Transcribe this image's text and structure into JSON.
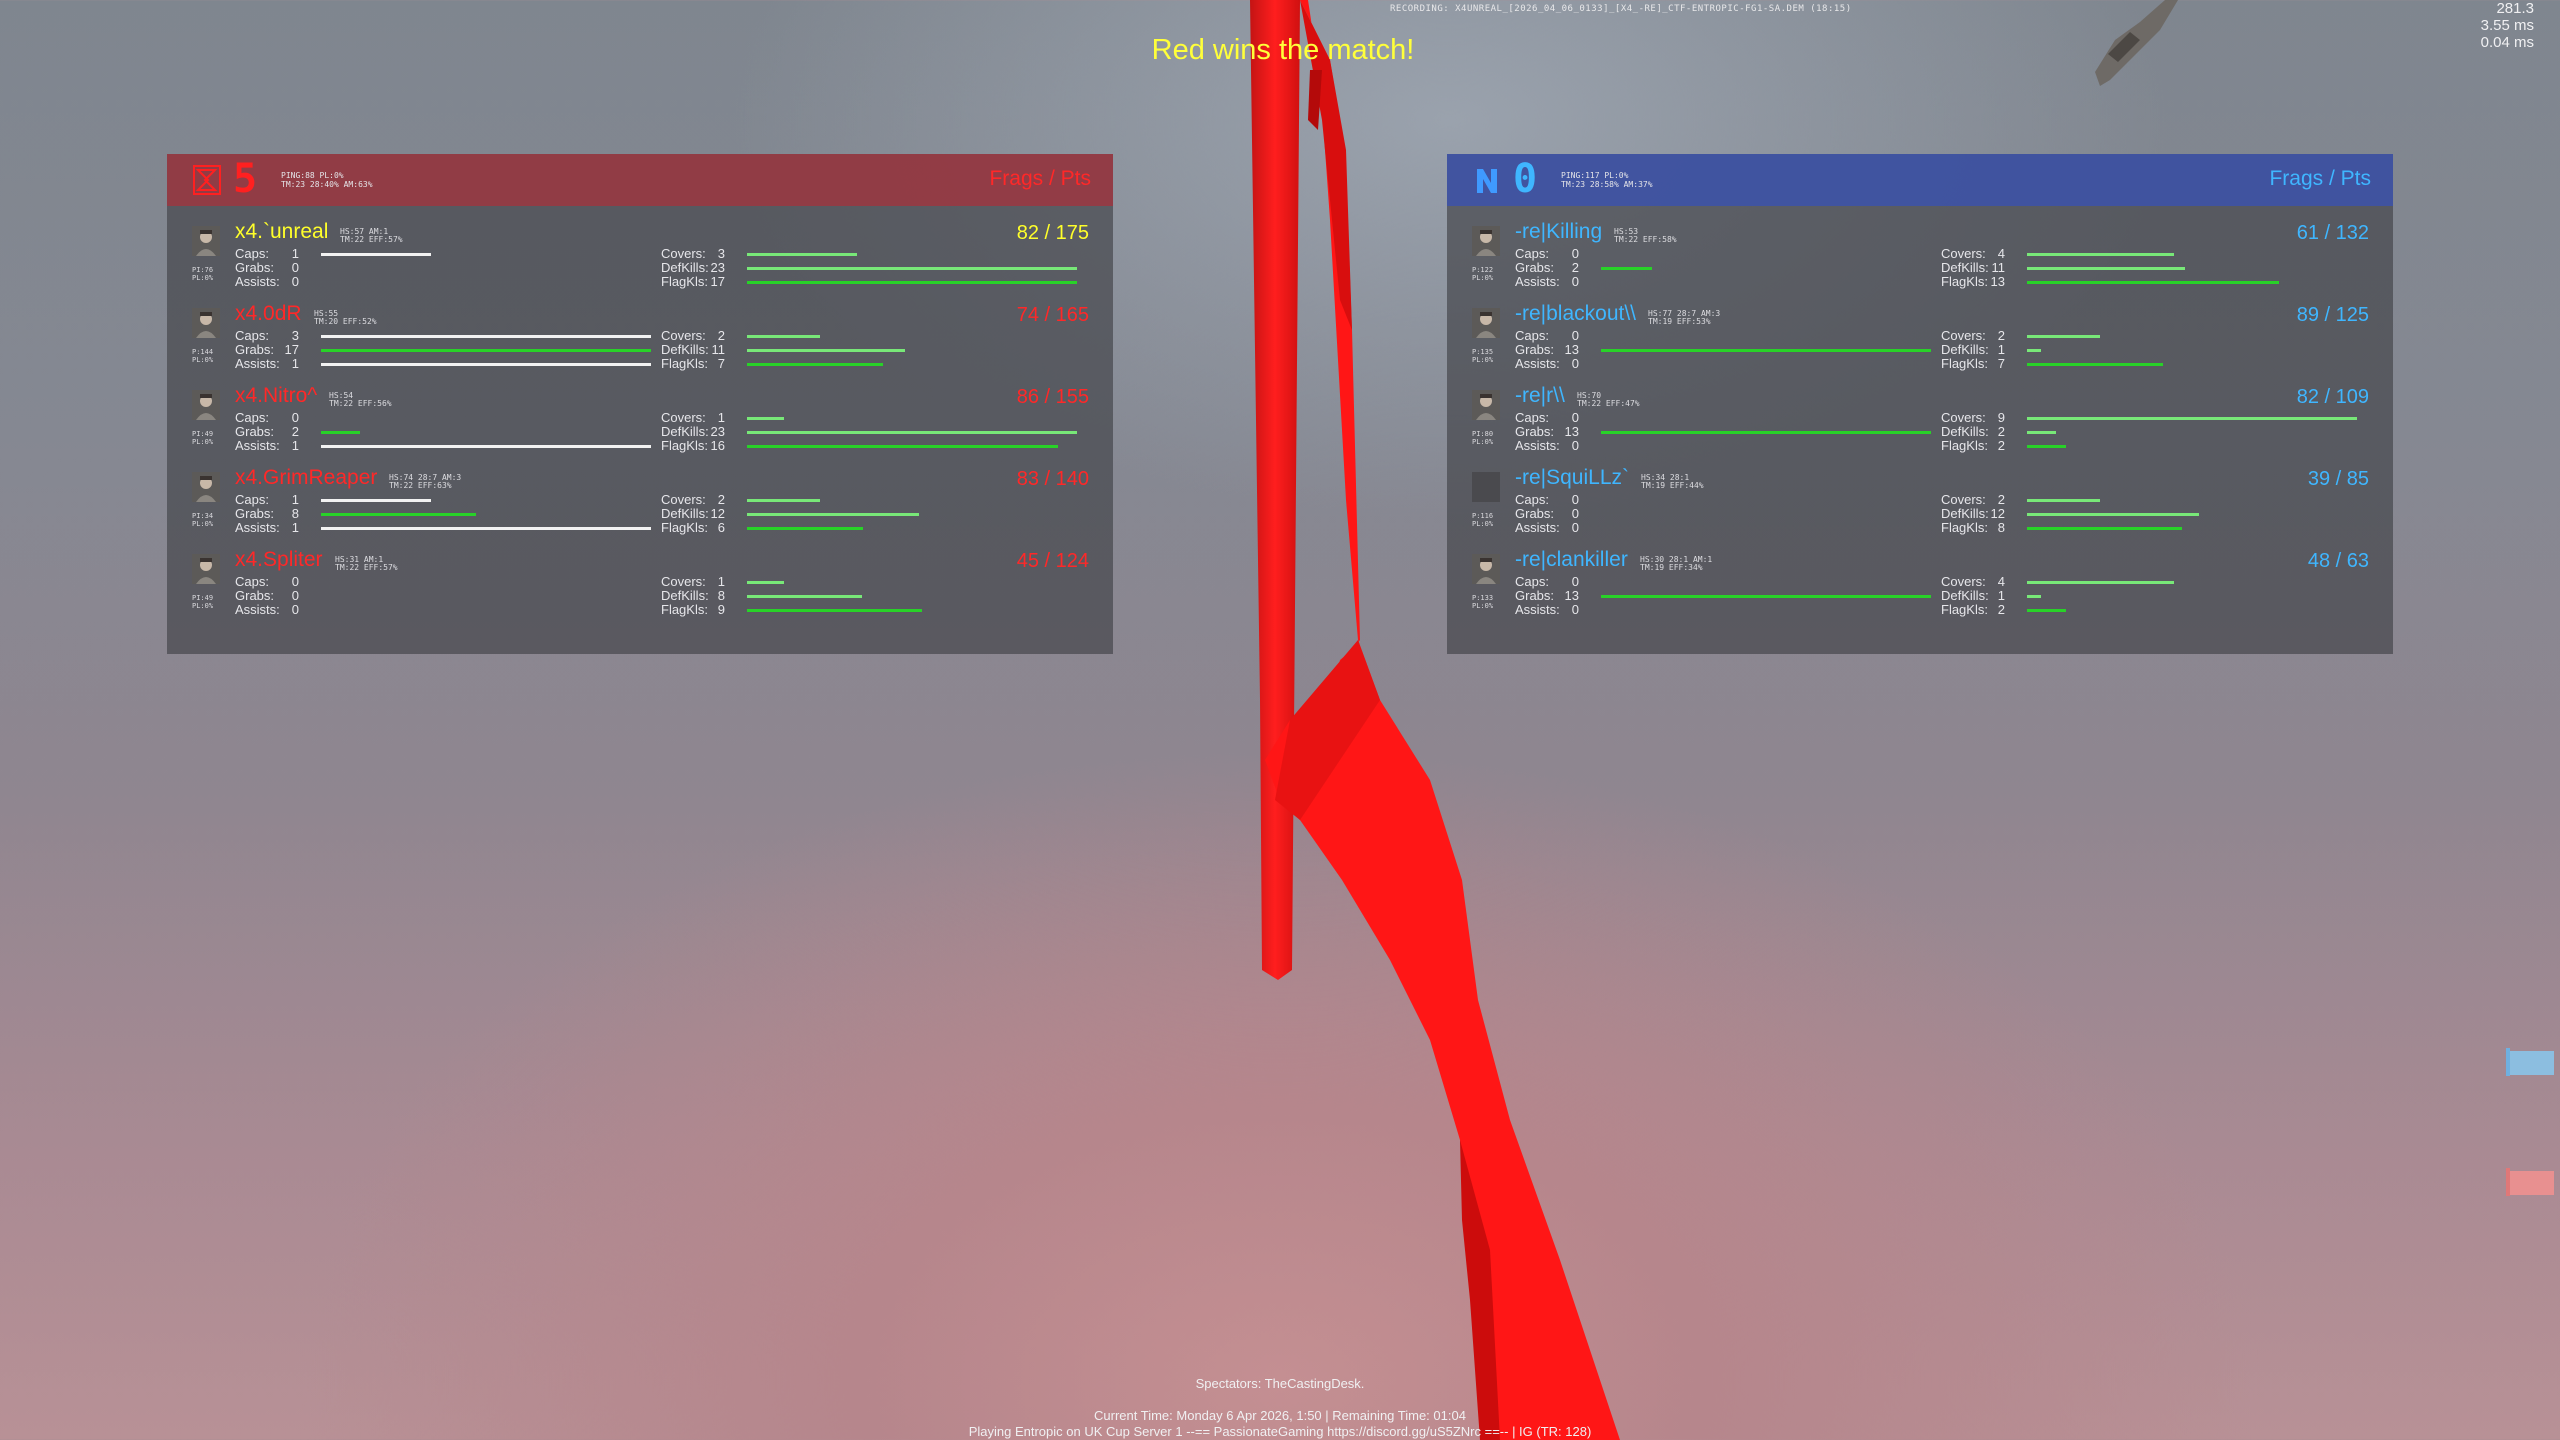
{
  "hud": {
    "recording": "RECORDING: X4UNREAL_[2026_04_06_0133]_[X4_-RE]_CTF-ENTROPIC-FG1-SA.DEM (18:15)",
    "fps": "281.3",
    "frame_ms": "3.55 ms",
    "ping_ms": "0.04 ms",
    "winner": "Red wins the match!",
    "spectators": "Spectators: TheCastingDesk.",
    "current_time": "Current Time: Monday 6 Apr 2026, 1:50 | Remaining Time: 01:04",
    "server": "Playing Entropic on UK Cup Server 1 --== PassionateGaming https://discord.gg/uS5ZNrc ==-- | IG (TR: 128)"
  },
  "colors": {
    "red_team": "#ff2828",
    "blue_team": "#3fb6ff",
    "highlight": "#ffff2a",
    "bar_white": "#f2f2f2",
    "bar_green": "#28d228"
  },
  "teams": [
    {
      "side": "red",
      "score": "5",
      "flag_icon": "red-team-flag-icon",
      "info_line1": "PING:88 PL:0%",
      "info_line2": "TM:23 28:40% AM:63%",
      "frags_pts_header": "Frags / Pts",
      "players": [
        {
          "name": "x4.`unreal",
          "highlight": true,
          "meta1": "HS:57 AM:1",
          "meta2": "TM:22 EFF:57%",
          "pi": "PI:76",
          "pl": "PL:0%",
          "score": "82 / 175",
          "caps": "1",
          "grabs": "0",
          "assists": "0",
          "covers": "3",
          "defkills": "23",
          "flagkills": "17",
          "caps_frac": 0.333,
          "grabs_frac": 0.0,
          "assists_frac": 0.0,
          "covers_frac": 0.333,
          "defkills_frac": 1.0,
          "flagkills_frac": 1.0
        },
        {
          "name": "x4.0dR",
          "highlight": false,
          "meta1": "HS:55",
          "meta2": "TM:20 EFF:52%",
          "pi": "P:144",
          "pl": "PL:0%",
          "score": "74 / 165",
          "caps": "3",
          "grabs": "17",
          "assists": "1",
          "covers": "2",
          "defkills": "11",
          "flagkills": "7",
          "caps_frac": 1.0,
          "grabs_frac": 1.0,
          "assists_frac": 1.0,
          "covers_frac": 0.222,
          "defkills_frac": 0.478,
          "flagkills_frac": 0.412
        },
        {
          "name": "x4.Nitro^",
          "highlight": false,
          "meta1": "HS:54",
          "meta2": "TM:22 EFF:56%",
          "pi": "PI:49",
          "pl": "PL:0%",
          "score": "86 / 155",
          "caps": "0",
          "grabs": "2",
          "assists": "1",
          "covers": "1",
          "defkills": "23",
          "flagkills": "16",
          "caps_frac": 0.0,
          "grabs_frac": 0.118,
          "assists_frac": 1.0,
          "covers_frac": 0.111,
          "defkills_frac": 1.0,
          "flagkills_frac": 0.941
        },
        {
          "name": "x4.GrimReaper",
          "highlight": false,
          "meta1": "HS:74 28:7 AM:3",
          "meta2": "TM:22 EFF:63%",
          "pi": "PI:34",
          "pl": "PL:0%",
          "score": "83 / 140",
          "caps": "1",
          "grabs": "8",
          "assists": "1",
          "covers": "2",
          "defkills": "12",
          "flagkills": "6",
          "caps_frac": 0.333,
          "grabs_frac": 0.471,
          "assists_frac": 1.0,
          "covers_frac": 0.222,
          "defkills_frac": 0.522,
          "flagkills_frac": 0.353
        },
        {
          "name": "x4.Spliter",
          "highlight": false,
          "meta1": "HS:31 AM:1",
          "meta2": "TM:22 EFF:57%",
          "pi": "PI:49",
          "pl": "PL:0%",
          "score": "45 / 124",
          "caps": "0",
          "grabs": "0",
          "assists": "0",
          "covers": "1",
          "defkills": "8",
          "flagkills": "9",
          "caps_frac": 0.0,
          "grabs_frac": 0.0,
          "assists_frac": 0.0,
          "covers_frac": 0.111,
          "defkills_frac": 0.348,
          "flagkills_frac": 0.529
        }
      ]
    },
    {
      "side": "blue",
      "score": "0",
      "flag_icon": "blue-team-flag-icon",
      "info_line1": "PING:117 PL:0%",
      "info_line2": "TM:23 28:58% AM:37%",
      "frags_pts_header": "Frags / Pts",
      "players": [
        {
          "name": "-re|Killing",
          "highlight": false,
          "meta1": "HS:53",
          "meta2": "TM:22 EFF:58%",
          "pi": "P:122",
          "pl": "PL:0%",
          "score": "61 / 132",
          "caps": "0",
          "grabs": "2",
          "assists": "0",
          "covers": "4",
          "defkills": "11",
          "flagkills": "13",
          "caps_frac": 0.0,
          "grabs_frac": 0.154,
          "assists_frac": 0.0,
          "covers_frac": 0.444,
          "defkills_frac": 0.478,
          "flagkills_frac": 0.765
        },
        {
          "name": "-re|blackout\\\\",
          "highlight": false,
          "meta1": "HS:77 28:7 AM:3",
          "meta2": "TM:19 EFF:53%",
          "pi": "P:135",
          "pl": "PL:0%",
          "score": "89 / 125",
          "caps": "0",
          "grabs": "13",
          "assists": "0",
          "covers": "2",
          "defkills": "1",
          "flagkills": "7",
          "caps_frac": 0.0,
          "grabs_frac": 1.0,
          "assists_frac": 0.0,
          "covers_frac": 0.222,
          "defkills_frac": 0.043,
          "flagkills_frac": 0.412
        },
        {
          "name": "-re|r\\\\",
          "highlight": false,
          "meta1": "HS:70",
          "meta2": "TM:22 EFF:47%",
          "pi": "PI:80",
          "pl": "PL:0%",
          "score": "82 / 109",
          "caps": "0",
          "grabs": "13",
          "assists": "0",
          "covers": "9",
          "defkills": "2",
          "flagkills": "2",
          "caps_frac": 0.0,
          "grabs_frac": 1.0,
          "assists_frac": 0.0,
          "covers_frac": 1.0,
          "defkills_frac": 0.087,
          "flagkills_frac": 0.118
        },
        {
          "name": "-re|SquiLLz`",
          "highlight": false,
          "meta1": "HS:34 28:1",
          "meta2": "TM:19 EFF:44%",
          "pi": "P:116",
          "pl": "PL:0%",
          "score": "39 / 85",
          "caps": "0",
          "grabs": "0",
          "assists": "0",
          "covers": "2",
          "defkills": "12",
          "flagkills": "8",
          "caps_frac": 0.0,
          "grabs_frac": 0.0,
          "assists_frac": 0.0,
          "covers_frac": 0.222,
          "defkills_frac": 0.522,
          "flagkills_frac": 0.471
        },
        {
          "name": "-re|clankiller",
          "highlight": false,
          "meta1": "HS:30 28:1 AM:1",
          "meta2": "TM:19 EFF:34%",
          "pi": "P:133",
          "pl": "PL:0%",
          "score": "48 / 63",
          "caps": "0",
          "grabs": "13",
          "assists": "0",
          "covers": "4",
          "defkills": "1",
          "flagkills": "2",
          "caps_frac": 0.0,
          "grabs_frac": 1.0,
          "assists_frac": 0.0,
          "covers_frac": 0.444,
          "defkills_frac": 0.043,
          "flagkills_frac": 0.118
        }
      ]
    }
  ],
  "stat_labels": {
    "caps": "Caps:",
    "grabs": "Grabs:",
    "assists": "Assists:",
    "covers": "Covers:",
    "defkills": "DefKills:",
    "flagkills": "FlagKls:"
  }
}
